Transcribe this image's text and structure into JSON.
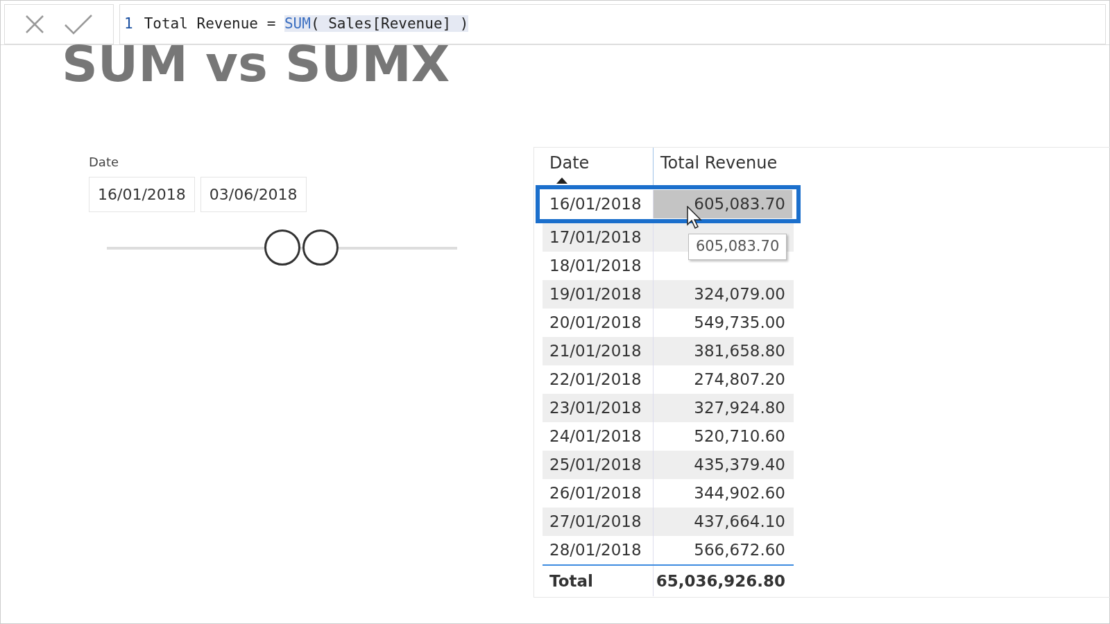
{
  "formula_bar": {
    "line_number": "1",
    "measure": "Total Revenue =",
    "function": "SUM",
    "arguments": "( Sales[Revenue] )"
  },
  "title": "SUM vs SUMX",
  "date_slicer": {
    "label": "Date",
    "start": "16/01/2018",
    "end": "03/06/2018"
  },
  "table": {
    "columns": [
      {
        "label": "Date",
        "sorted": true
      },
      {
        "label": "Total Revenue",
        "sorted": false
      }
    ],
    "rows": [
      {
        "date": "16/01/2018",
        "value": "605,083.70",
        "selected": true
      },
      {
        "date": "17/01/2018",
        "selected": false
      },
      {
        "date": "18/01/2018",
        "selected": false
      },
      {
        "date": "19/01/2018",
        "value": "324,079.00",
        "selected": false
      },
      {
        "date": "20/01/2018",
        "value": "549,735.00",
        "selected": false
      },
      {
        "date": "21/01/2018",
        "value": "381,658.80",
        "selected": false
      },
      {
        "date": "22/01/2018",
        "value": "274,807.20",
        "selected": false
      },
      {
        "date": "23/01/2018",
        "value": "327,924.80",
        "selected": false
      },
      {
        "date": "24/01/2018",
        "value": "520,710.60",
        "selected": false
      },
      {
        "date": "25/01/2018",
        "value": "435,379.40",
        "selected": false
      },
      {
        "date": "26/01/2018",
        "value": "344,902.60",
        "selected": false
      },
      {
        "date": "27/01/2018",
        "value": "437,664.10",
        "selected": false
      },
      {
        "date": "28/01/2018",
        "value": "566,672.60",
        "selected": false
      }
    ],
    "total": {
      "label": "Total",
      "value": "65,036,926.80"
    },
    "tooltip": "605,083.70"
  }
}
